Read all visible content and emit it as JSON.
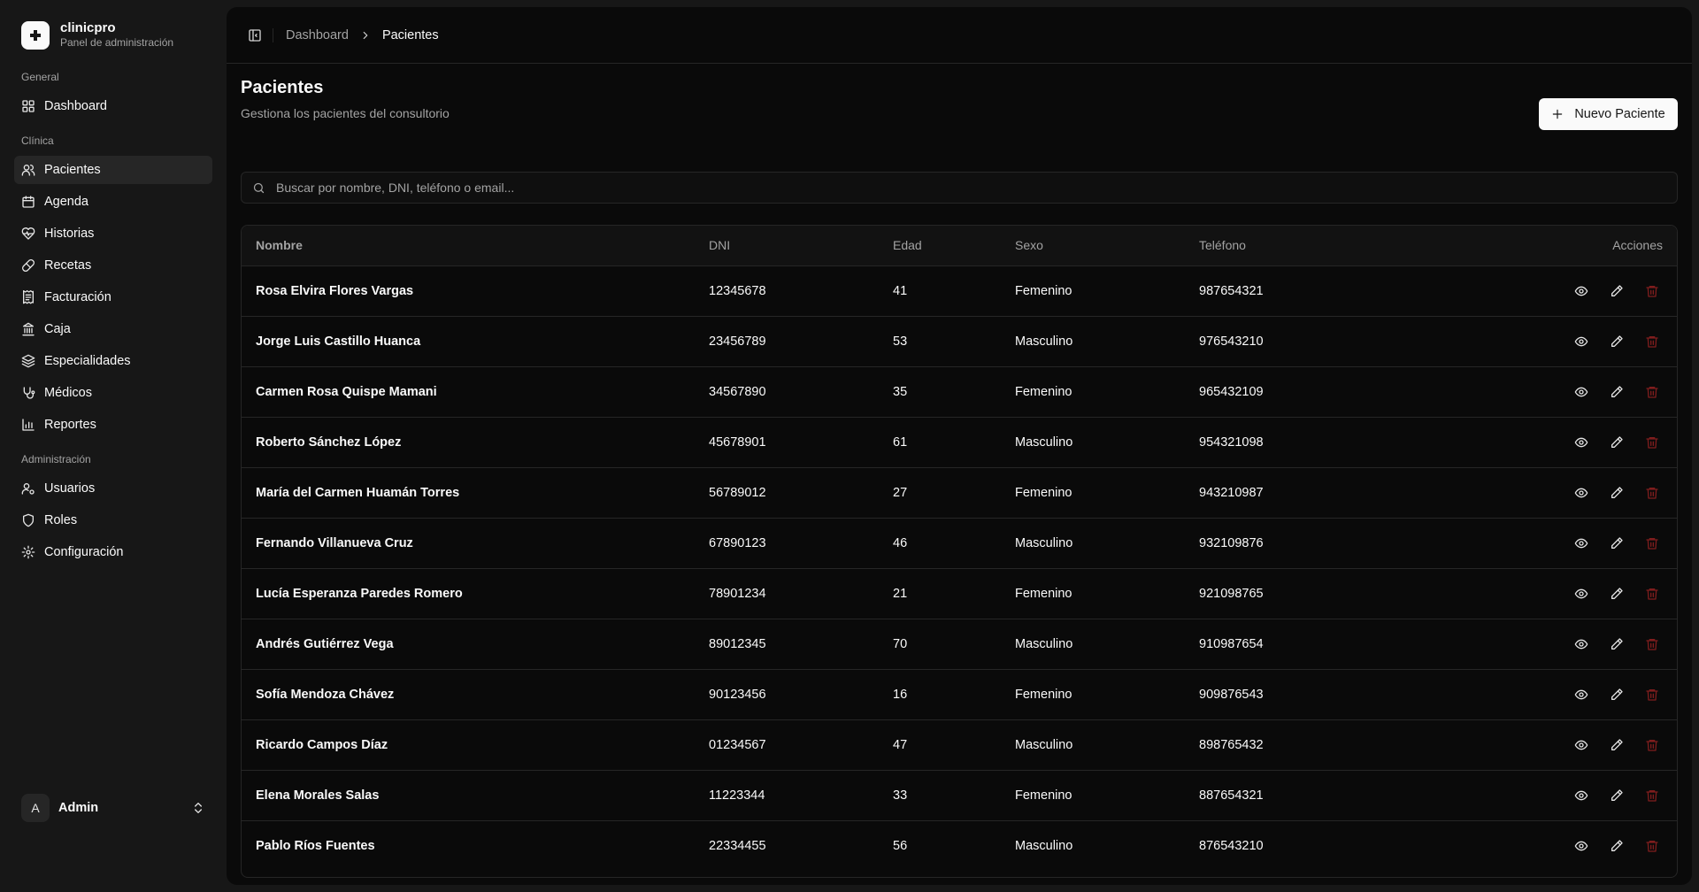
{
  "brand": {
    "name": "clinicpro",
    "subtitle": "Panel de administración"
  },
  "sidebar": {
    "groups": [
      {
        "label": "General"
      },
      {
        "label": "Clínica"
      },
      {
        "label": "Administración"
      }
    ],
    "items": [
      {
        "label": "Dashboard",
        "icon": "grid-icon"
      },
      {
        "label": "Pacientes",
        "icon": "users-icon",
        "active": true
      },
      {
        "label": "Agenda",
        "icon": "calendar-icon"
      },
      {
        "label": "Historias",
        "icon": "heart-pulse-icon"
      },
      {
        "label": "Recetas",
        "icon": "pill-icon"
      },
      {
        "label": "Facturación",
        "icon": "receipt-icon"
      },
      {
        "label": "Caja",
        "icon": "landmark-icon"
      },
      {
        "label": "Especialidades",
        "icon": "layers-icon"
      },
      {
        "label": "Médicos",
        "icon": "stethoscope-icon"
      },
      {
        "label": "Reportes",
        "icon": "bar-chart-icon"
      },
      {
        "label": "Usuarios",
        "icon": "user-cog-icon"
      },
      {
        "label": "Roles",
        "icon": "shield-icon"
      },
      {
        "label": "Configuración",
        "icon": "gear-icon"
      }
    ],
    "user": {
      "initial": "A",
      "name": "Admin"
    }
  },
  "breadcrumb": {
    "parent": "Dashboard",
    "current": "Pacientes"
  },
  "page": {
    "title": "Pacientes",
    "subtitle": "Gestiona los pacientes del consultorio",
    "new_button": "Nuevo Paciente"
  },
  "search": {
    "placeholder": "Buscar por nombre, DNI, teléfono o email...",
    "value": ""
  },
  "table": {
    "headers": {
      "name": "Nombre",
      "dni": "DNI",
      "age": "Edad",
      "sex": "Sexo",
      "phone": "Teléfono",
      "actions": "Acciones"
    },
    "rows": [
      {
        "name": "Rosa Elvira Flores Vargas",
        "dni": "12345678",
        "age": "41",
        "sex": "Femenino",
        "phone": "987654321"
      },
      {
        "name": "Jorge Luis Castillo Huanca",
        "dni": "23456789",
        "age": "53",
        "sex": "Masculino",
        "phone": "976543210"
      },
      {
        "name": "Carmen Rosa Quispe Mamani",
        "dni": "34567890",
        "age": "35",
        "sex": "Femenino",
        "phone": "965432109"
      },
      {
        "name": "Roberto Sánchez López",
        "dni": "45678901",
        "age": "61",
        "sex": "Masculino",
        "phone": "954321098"
      },
      {
        "name": "María del Carmen Huamán Torres",
        "dni": "56789012",
        "age": "27",
        "sex": "Femenino",
        "phone": "943210987"
      },
      {
        "name": "Fernando Villanueva Cruz",
        "dni": "67890123",
        "age": "46",
        "sex": "Masculino",
        "phone": "932109876"
      },
      {
        "name": "Lucía Esperanza Paredes Romero",
        "dni": "78901234",
        "age": "21",
        "sex": "Femenino",
        "phone": "921098765"
      },
      {
        "name": "Andrés Gutiérrez Vega",
        "dni": "89012345",
        "age": "70",
        "sex": "Masculino",
        "phone": "910987654"
      },
      {
        "name": "Sofía Mendoza Chávez",
        "dni": "90123456",
        "age": "16",
        "sex": "Femenino",
        "phone": "909876543"
      },
      {
        "name": "Ricardo Campos Díaz",
        "dni": "01234567",
        "age": "47",
        "sex": "Masculino",
        "phone": "898765432"
      },
      {
        "name": "Elena Morales Salas",
        "dni": "11223344",
        "age": "33",
        "sex": "Femenino",
        "phone": "887654321"
      },
      {
        "name": "Pablo Ríos Fuentes",
        "dni": "22334455",
        "age": "56",
        "sex": "Masculino",
        "phone": "876543210"
      }
    ]
  },
  "colors": {
    "background": "#0a0a0a",
    "sidebar": "#171717",
    "border": "#262626",
    "muted": "#a3a3a3",
    "danger": "#7f1d1d"
  }
}
